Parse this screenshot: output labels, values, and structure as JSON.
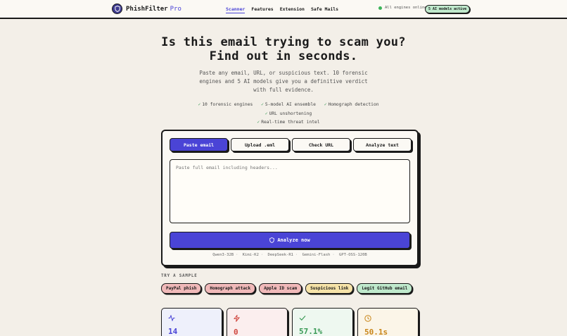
{
  "nav": {
    "brand": "PhishFilter",
    "brand_suffix": "Pro",
    "links": [
      "Scanner",
      "Features",
      "Extension",
      "Safe Mails"
    ],
    "status_text": "All engines online",
    "models_badge": "5 AI models active"
  },
  "hero": {
    "title_line1": "Is this email trying to scam you?",
    "title_line2": "Find out in seconds.",
    "subtitle": "Paste any email, URL, or suspicious text. 10 forensic engines and 5 AI models give you a definitive verdict with full evidence.",
    "features": [
      "10 forensic engines",
      "5-model AI ensemble",
      "Homograph detection",
      "URL unshortening",
      "Real-time threat intel"
    ]
  },
  "scanner": {
    "tabs": [
      "Paste email",
      "Upload .eml",
      "Check URL",
      "Analyze text"
    ],
    "active_tab": "Paste email",
    "input_placeholder": "Paste full email including headers...",
    "analyze_label": "Analyze now",
    "models": [
      "Qwen3-32B",
      "Kimi-K2",
      "DeepSeek-R1",
      "Gemini-Flash",
      "GPT-OSS-120B"
    ]
  },
  "samples": {
    "label": "TRY A SAMPLE",
    "items": [
      {
        "label": "PayPal phish",
        "color": "#f0b9b9"
      },
      {
        "label": "Homograph attack",
        "color": "#f0b9b9"
      },
      {
        "label": "Apple ID scam",
        "color": "#f0b9b9"
      },
      {
        "label": "Suspicious link",
        "color": "#f6e3a8"
      },
      {
        "label": "Legit GitHub email",
        "color": "#bfe9cc"
      }
    ]
  },
  "stats": [
    {
      "icon": "activity-icon",
      "value": "14",
      "color": "#4a44d6",
      "bg": "#eef0fb"
    },
    {
      "icon": "zap-icon",
      "value": "0",
      "color": "#d0473f",
      "bg": "#fbeeee"
    },
    {
      "icon": "check-icon",
      "value": "57.1%",
      "color": "#3a9a56",
      "bg": "#eef8f0"
    },
    {
      "icon": "clock-icon",
      "value": "50.1s",
      "color": "#c9861a",
      "bg": "#fbf5e8"
    }
  ]
}
